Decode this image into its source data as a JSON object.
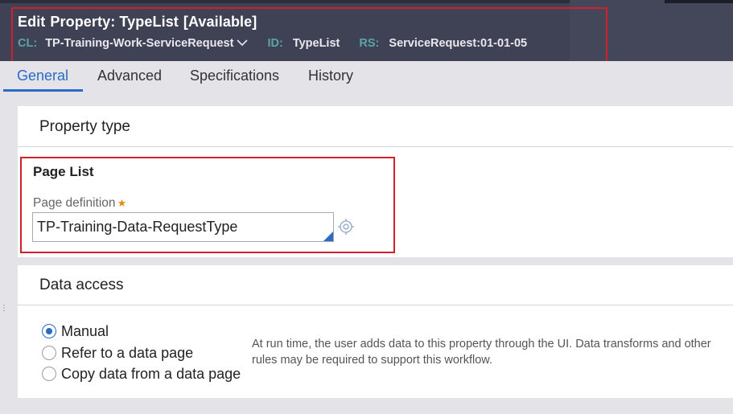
{
  "header": {
    "title_prefix": "Edit",
    "title_rule": "Property: TypeList",
    "title_status": "[Available]",
    "class_label": "CL:",
    "class_value": "TP-Training-Work-ServiceRequest",
    "id_label": "ID:",
    "id_value": "TypeList",
    "ruleset_label": "RS:",
    "ruleset_value": "ServiceRequest:01-01-05",
    "chevron_icon": "chevron-down-icon"
  },
  "tabs": [
    {
      "label": "General",
      "active": true
    },
    {
      "label": "Advanced",
      "active": false
    },
    {
      "label": "Specifications",
      "active": false
    },
    {
      "label": "History",
      "active": false
    }
  ],
  "property_type": {
    "title": "Property type",
    "type_label": "Page List",
    "page_definition_label": "Page definition",
    "required_marker": "★",
    "page_definition_value": "TP-Training-Data-RequestType",
    "target_icon": "crosshair-target-icon"
  },
  "data_access": {
    "title": "Data access",
    "options": [
      {
        "label": "Manual",
        "checked": true
      },
      {
        "label": "Refer to a data page",
        "checked": false
      },
      {
        "label": "Copy data from a data page",
        "checked": false
      }
    ],
    "help_text": "At run time, the user adds data to this property through the UI. Data transforms and other rules may be required to support this workflow."
  },
  "colors": {
    "header_bg": "#3f4255",
    "accent": "#2a6ac8",
    "highlight_box": "#d0202c",
    "meta_label": "#5ba4a8",
    "required": "#e08a1c"
  }
}
